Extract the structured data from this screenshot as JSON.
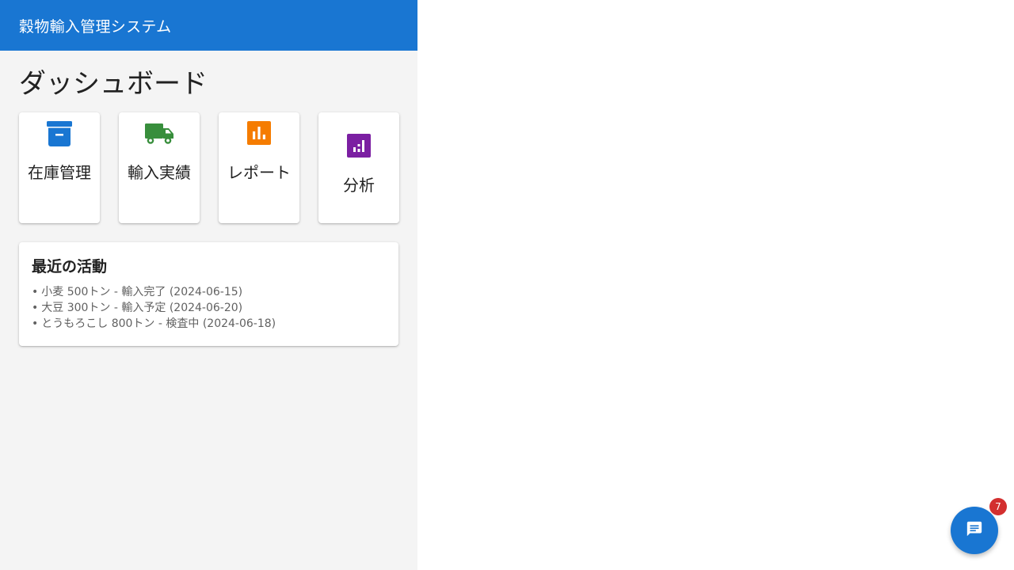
{
  "app": {
    "title": "穀物輸入管理システム",
    "brand_color": "#1976d2",
    "background_color": "#f4f4f4"
  },
  "dashboard": {
    "title": "ダッシュボード",
    "tiles": [
      {
        "label": "在庫管理",
        "icon": "archive-box-icon",
        "color": "#1976d2"
      },
      {
        "label": "輸入実績",
        "icon": "truck-icon",
        "color": "#388e3c"
      },
      {
        "label": "レポート",
        "icon": "bar-chart-icon",
        "color": "#f57c00"
      },
      {
        "label": "分析",
        "icon": "analytics-icon",
        "color": "#7b1fa2"
      }
    ]
  },
  "activity": {
    "title": "最近の活動",
    "bullet": "•",
    "items": [
      "小麦 500トン - 輸入完了 (2024-06-15)",
      "大豆 300トン - 輸入予定 (2024-06-20)",
      "とうもろこし 800トン - 検査中 (2024-06-18)"
    ]
  },
  "chat_fab": {
    "icon": "chat-icon",
    "badge_count": "7",
    "badge_color": "#d32f2f"
  }
}
